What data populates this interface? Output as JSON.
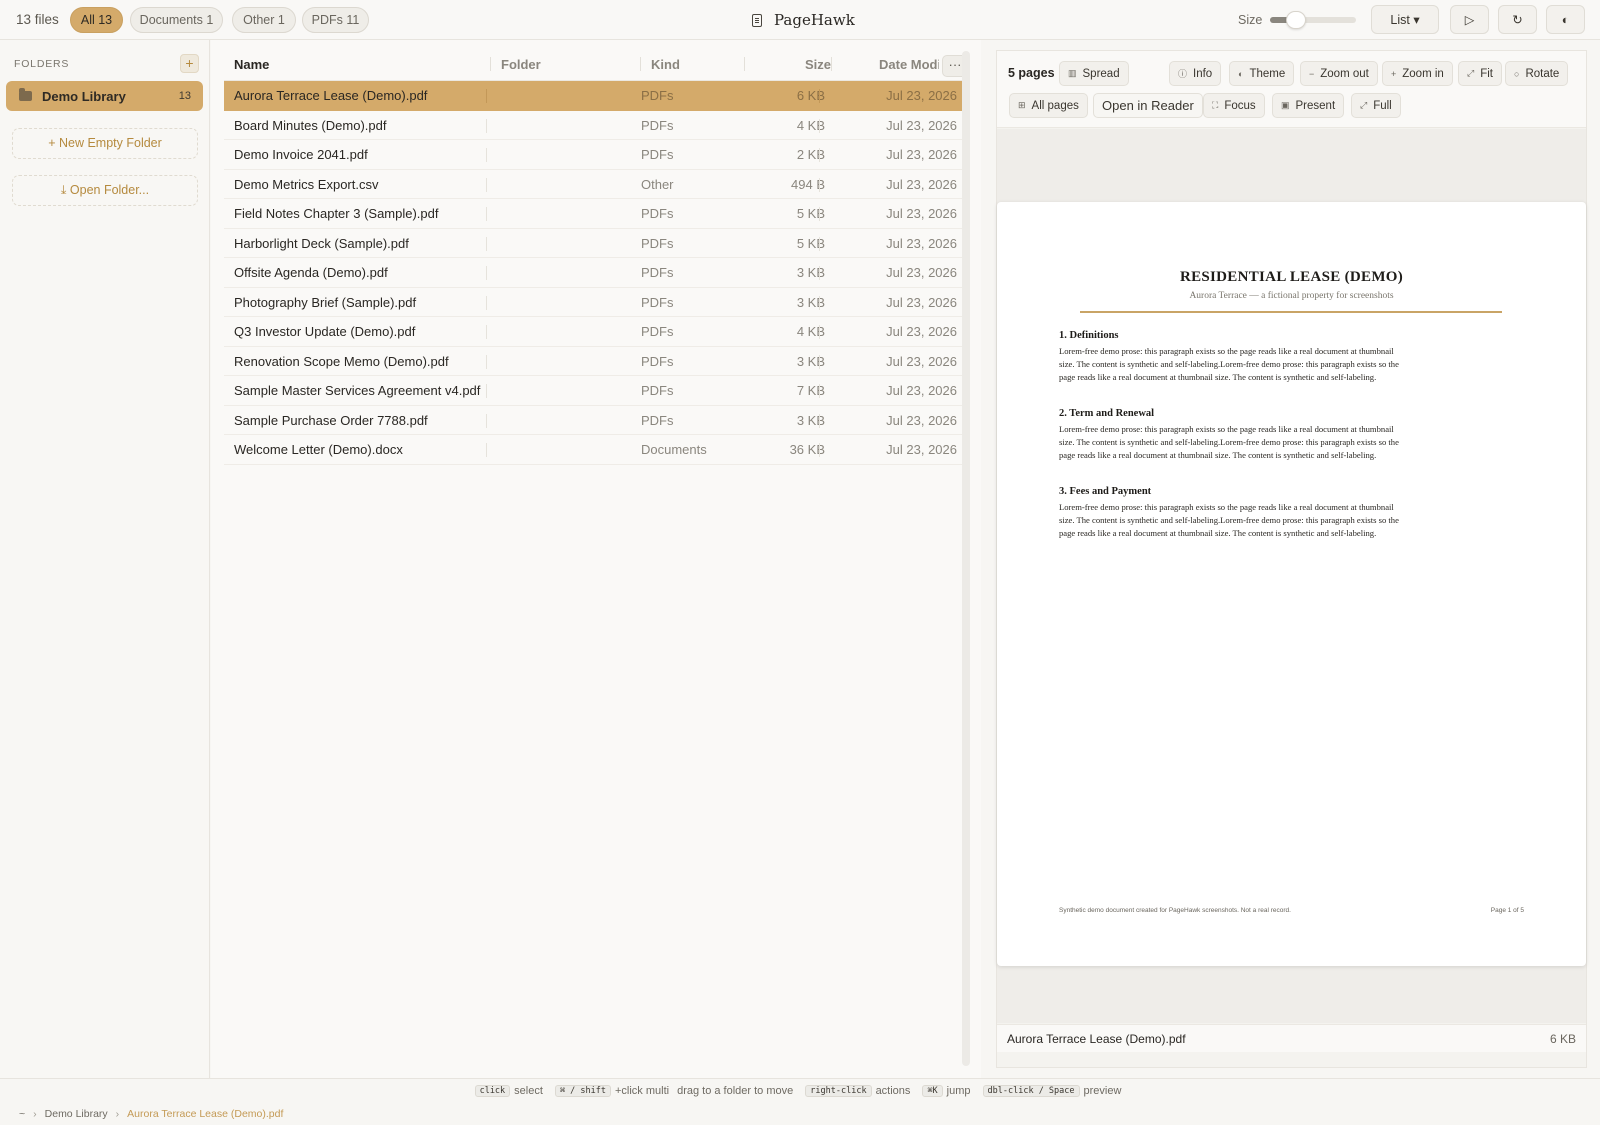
{
  "topbar": {
    "file_count": "13 files",
    "filters": [
      {
        "label": "All 13",
        "active": true
      },
      {
        "label": "Documents 1",
        "active": false
      },
      {
        "label": "Other 1",
        "active": false
      },
      {
        "label": "PDFs 11",
        "active": false
      }
    ],
    "app_name": "PageHawk",
    "size_label": "Size",
    "size_slider_value": 0.3,
    "view_button": "List ▾",
    "play_icon": "▷",
    "refresh_icon": "↻",
    "theme_icon": "◐"
  },
  "sidebar": {
    "heading": "FOLDERS",
    "add_icon": "+",
    "folder": {
      "name": "Demo Library",
      "count": "13"
    },
    "new_folder": "+ New Empty Folder",
    "open_folder": "⤓ Open Folder..."
  },
  "table": {
    "headers": {
      "name": "Name",
      "folder": "Folder",
      "kind": "Kind",
      "size": "Size",
      "date": "Date Modi"
    },
    "more": "···",
    "rows": [
      {
        "name": "Aurora Terrace Lease (Demo).pdf",
        "kind": "PDFs",
        "size": "6 KB",
        "date": "Jul 23, 2026"
      },
      {
        "name": "Board Minutes (Demo).pdf",
        "kind": "PDFs",
        "size": "4 KB",
        "date": "Jul 23, 2026"
      },
      {
        "name": "Demo Invoice 2041.pdf",
        "kind": "PDFs",
        "size": "2 KB",
        "date": "Jul 23, 2026"
      },
      {
        "name": "Demo Metrics Export.csv",
        "kind": "Other",
        "size": "494 B",
        "date": "Jul 23, 2026"
      },
      {
        "name": "Field Notes Chapter 3 (Sample).pdf",
        "kind": "PDFs",
        "size": "5 KB",
        "date": "Jul 23, 2026"
      },
      {
        "name": "Harborlight Deck (Sample).pdf",
        "kind": "PDFs",
        "size": "5 KB",
        "date": "Jul 23, 2026"
      },
      {
        "name": "Offsite Agenda (Demo).pdf",
        "kind": "PDFs",
        "size": "3 KB",
        "date": "Jul 23, 2026"
      },
      {
        "name": "Photography Brief (Sample).pdf",
        "kind": "PDFs",
        "size": "3 KB",
        "date": "Jul 23, 2026"
      },
      {
        "name": "Q3 Investor Update (Demo).pdf",
        "kind": "PDFs",
        "size": "4 KB",
        "date": "Jul 23, 2026"
      },
      {
        "name": "Renovation Scope Memo (Demo).pdf",
        "kind": "PDFs",
        "size": "3 KB",
        "date": "Jul 23, 2026"
      },
      {
        "name": "Sample Master Services Agreement v4.pdf",
        "kind": "PDFs",
        "size": "7 KB",
        "date": "Jul 23, 2026"
      },
      {
        "name": "Sample Purchase Order 7788.pdf",
        "kind": "PDFs",
        "size": "3 KB",
        "date": "Jul 23, 2026"
      },
      {
        "name": "Welcome Letter (Demo).docx",
        "kind": "Documents",
        "size": "36 KB",
        "date": "Jul 23, 2026"
      }
    ]
  },
  "preview": {
    "pages": "5 pages",
    "spread": "Spread",
    "info": "Info",
    "theme": "Theme",
    "zoom_out": "Zoom out",
    "zoom_in": "Zoom in",
    "fit": "Fit",
    "rotate": "Rotate",
    "all_pages": "All pages",
    "open_reader": "Open in Reader",
    "focus": "Focus",
    "present": "Present",
    "full": "Full",
    "doc": {
      "title": "RESIDENTIAL LEASE (DEMO)",
      "subtitle": "Aurora Terrace — a fictional property for screenshots",
      "sections": [
        {
          "heading": "1. Definitions",
          "body": "Lorem-free demo prose: this paragraph exists so the page reads like a real document at thumbnail size. The content is synthetic and self-labeling.Lorem-free demo prose: this paragraph exists so the page reads like a real document at thumbnail size. The content is synthetic and self-labeling."
        },
        {
          "heading": "2. Term and Renewal",
          "body": "Lorem-free demo prose: this paragraph exists so the page reads like a real document at thumbnail size. The content is synthetic and self-labeling.Lorem-free demo prose: this paragraph exists so the page reads like a real document at thumbnail size. The content is synthetic and self-labeling."
        },
        {
          "heading": "3. Fees and Payment",
          "body": "Lorem-free demo prose: this paragraph exists so the page reads like a real document at thumbnail size. The content is synthetic and self-labeling.Lorem-free demo prose: this paragraph exists so the page reads like a real document at thumbnail size. The content is synthetic and self-labeling."
        }
      ],
      "footer_left": "Synthetic demo document created for PageHawk screenshots. Not a real record.",
      "footer_right": "Page 1 of 5"
    },
    "footer_name": "Aurora Terrace Lease (Demo).pdf",
    "footer_size": "6 KB"
  },
  "hints": [
    {
      "key": "click",
      "text": "select"
    },
    {
      "key": "⌘ / shift",
      "text": "+click multi"
    },
    {
      "key": "",
      "text": "drag to a folder to move"
    },
    {
      "key": "right-click",
      "text": "actions"
    },
    {
      "key": "⌘K",
      "text": "jump"
    },
    {
      "key": "dbl-click / Space",
      "text": "preview"
    }
  ],
  "breadcrumb": {
    "root": "~",
    "folder": "Demo Library",
    "file": "Aurora Terrace Lease (Demo).pdf"
  }
}
